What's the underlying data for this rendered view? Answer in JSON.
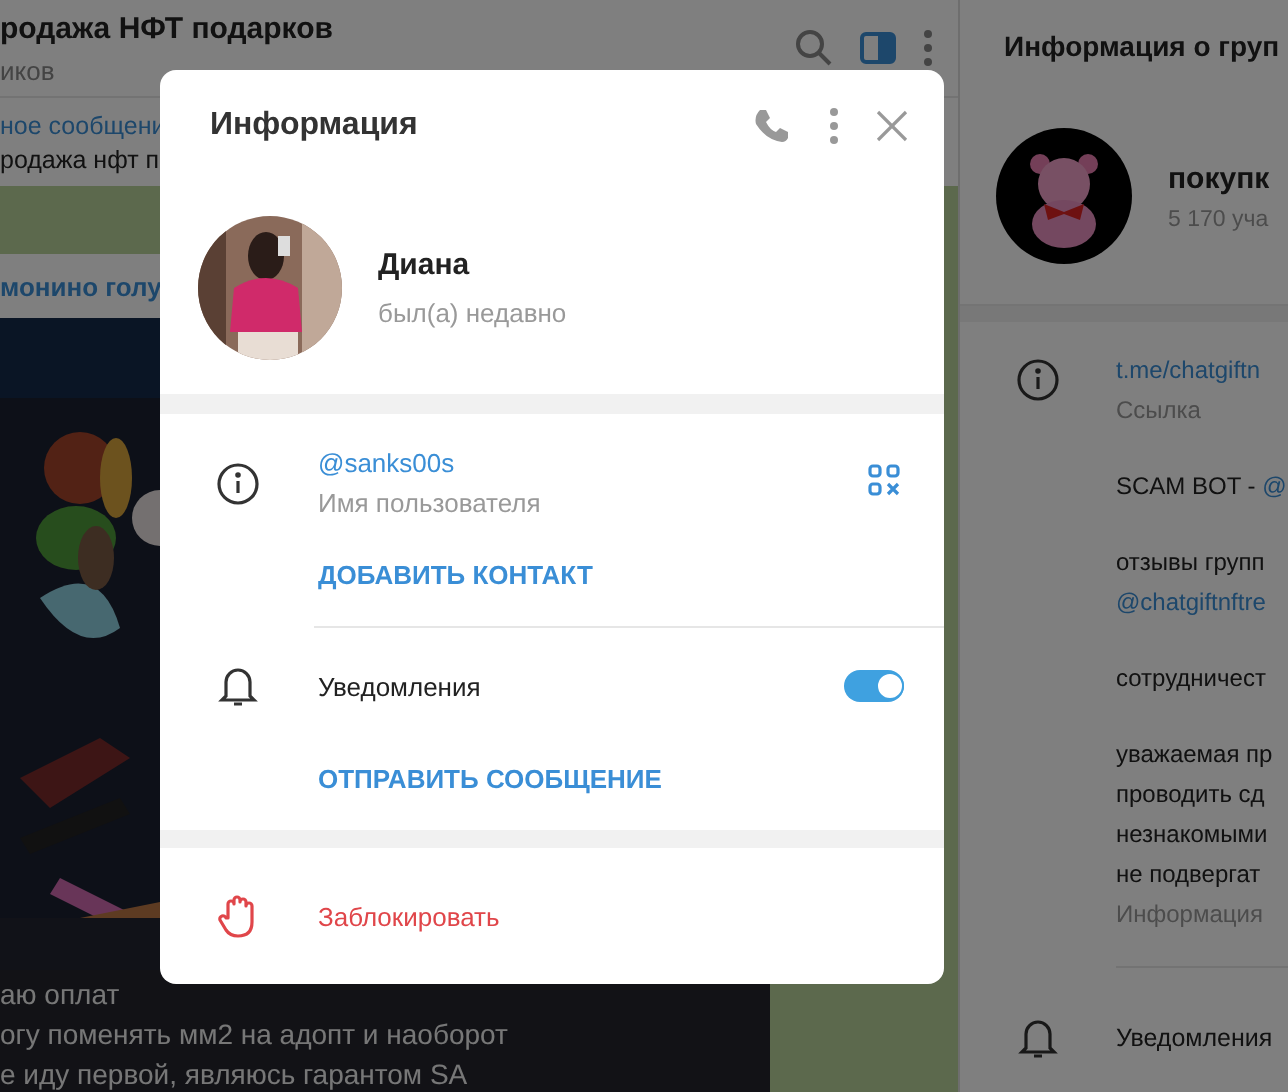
{
  "chat": {
    "title": "родажа НФТ подарков",
    "subtitle": "иков",
    "pinned": {
      "label": "ное сообщени",
      "text": "родажа нфт п"
    },
    "message": {
      "sender": "монино голу",
      "kind": "picture",
      "lines": [
        "аю оплат",
        "огу поменять мм2 на адопт и наоборот",
        "е иду первой, являюсь гарантом SA"
      ]
    }
  },
  "group_info": {
    "title": "Информация о груп",
    "name": "покупк",
    "members": "5 170 уча",
    "link": "t.me/chatgiftn",
    "link_label": "Ссылка",
    "description": [
      [
        [
          {
            "text": "SCAM BOT - ",
            "kind": "text"
          },
          {
            "text": "@",
            "kind": "link"
          }
        ]
      ],
      [
        [
          {
            "text": "отзывы групп",
            "kind": "text"
          }
        ],
        [
          {
            "text": "@chatgiftnftre",
            "kind": "link"
          }
        ]
      ],
      [
        [
          {
            "text": "сотрудничест",
            "kind": "text"
          }
        ]
      ],
      [
        [
          {
            "text": "уважаемая пр",
            "kind": "text"
          }
        ],
        [
          {
            "text": "проводить сд",
            "kind": "text"
          }
        ],
        [
          {
            "text": "незнакомыми",
            "kind": "text"
          }
        ],
        [
          {
            "text": "не подвергат",
            "kind": "text"
          }
        ]
      ]
    ],
    "description_label": "Информация",
    "notifications_label": "Уведомления"
  },
  "dialog": {
    "title": "Информация",
    "name": "Диана",
    "status": "был(а) недавно",
    "username": "@sanks00s",
    "username_label": "Имя пользователя",
    "add_contact": "ДОБАВИТЬ КОНТАКТ",
    "notifications": {
      "label": "Уведомления",
      "on": true
    },
    "send_message": "ОТПРАВИТЬ СООБЩЕНИЕ",
    "block": "Заблокировать"
  }
}
